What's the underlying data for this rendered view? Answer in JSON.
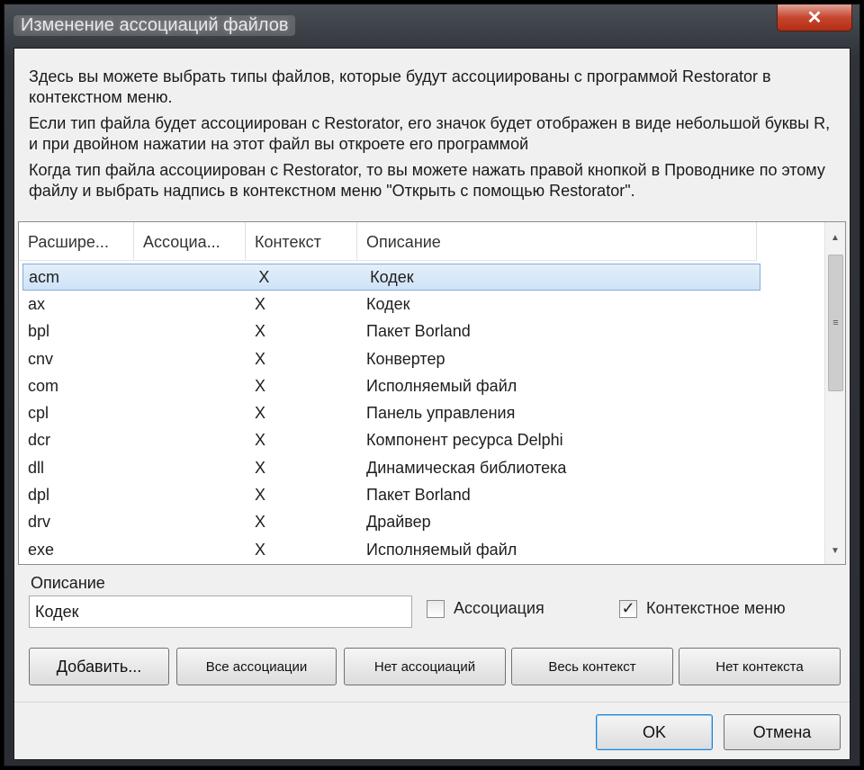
{
  "window": {
    "title": "Изменение ассоциаций файлов",
    "close_label": "✕"
  },
  "intro": {
    "p1": "Здесь вы можете выбрать типы файлов, которые будут ассоциированы с программой Restorator в контекстном меню.",
    "p2": "Если тип файла будет ассоциирован с Restorator, его значок будет отображен в виде небольшой буквы R, и при двойном нажатии на этот файл вы откроете его программой",
    "p3": "Когда тип файла ассоциирован с Restorator, то вы можете нажать правой кнопкой в Проводнике по этому файлу и выбрать надпись в контекстном меню \"Открыть с помощью Restorator\"."
  },
  "list": {
    "columns": [
      "Расшире...",
      "Ассоциа...",
      "Контекст",
      "Описание"
    ],
    "rows": [
      {
        "ext": "acm",
        "assoc": "",
        "context": "X",
        "desc": "Кодек"
      },
      {
        "ext": "ax",
        "assoc": "",
        "context": "X",
        "desc": "Кодек"
      },
      {
        "ext": "bpl",
        "assoc": "",
        "context": "X",
        "desc": "Пакет Borland"
      },
      {
        "ext": "cnv",
        "assoc": "",
        "context": "X",
        "desc": "Конвертер"
      },
      {
        "ext": "com",
        "assoc": "",
        "context": "X",
        "desc": "Исполняемый файл"
      },
      {
        "ext": "cpl",
        "assoc": "",
        "context": "X",
        "desc": "Панель управления"
      },
      {
        "ext": "dcr",
        "assoc": "",
        "context": "X",
        "desc": "Компонент ресурса Delphi"
      },
      {
        "ext": "dll",
        "assoc": "",
        "context": "X",
        "desc": "Динамическая библиотека"
      },
      {
        "ext": "dpl",
        "assoc": "",
        "context": "X",
        "desc": "Пакет Borland"
      },
      {
        "ext": "drv",
        "assoc": "",
        "context": "X",
        "desc": "Драйвер"
      },
      {
        "ext": "exe",
        "assoc": "",
        "context": "X",
        "desc": "Исполняемый файл"
      }
    ],
    "scroll_thumb_glyph": "≡"
  },
  "description": {
    "label": "Описание",
    "value": "Кодек"
  },
  "checkboxes": {
    "association": {
      "label": "Ассоциация",
      "checked": false
    },
    "context_menu": {
      "label": "Контекстное меню",
      "checked": true,
      "check_glyph": "✓"
    }
  },
  "buttons": {
    "add": "Добавить...",
    "all_assoc": "Все ассоциации",
    "no_assoc": "Нет ассоциаций",
    "all_context": "Весь контекст",
    "no_context": "Нет контекста",
    "ok": "OK",
    "cancel": "Отмена"
  }
}
